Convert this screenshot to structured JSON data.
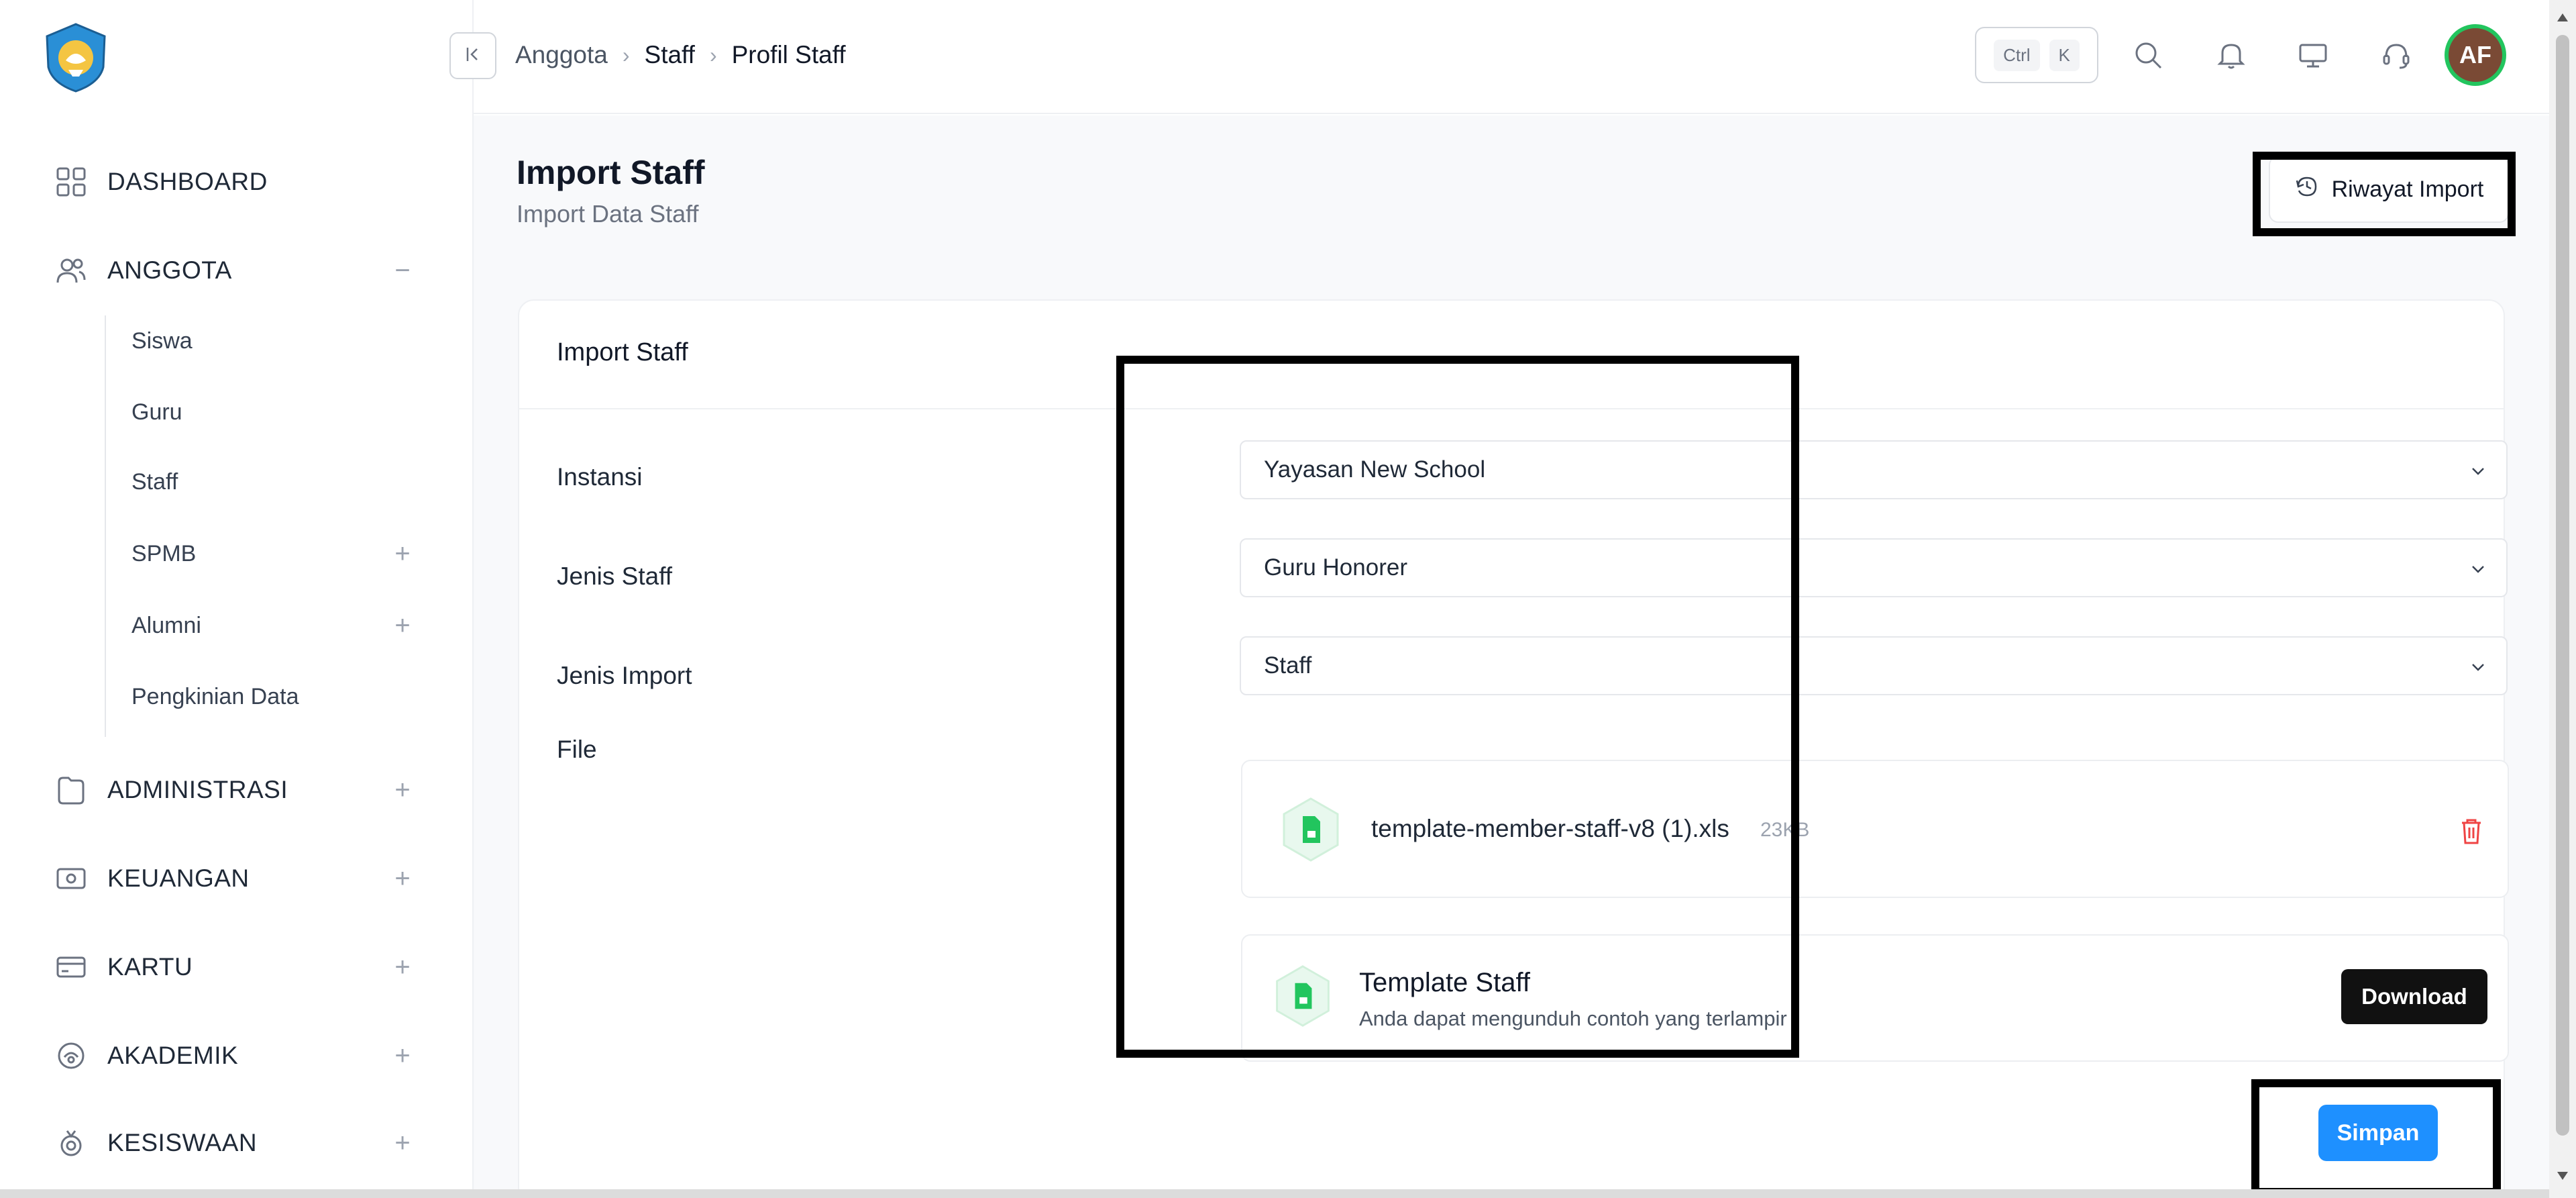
{
  "app": {
    "logo_name": "tut-wuri-handayani-logo"
  },
  "topbar": {
    "breadcrumb": [
      "Anggota",
      "Staff",
      "Profil Staff"
    ],
    "shortcut_keys": [
      "Ctrl",
      "K"
    ],
    "avatar_initials": "AF"
  },
  "sidebar": {
    "items": [
      {
        "label": "DASHBOARD",
        "icon": "grid-icon"
      },
      {
        "label": "ANGGOTA",
        "icon": "users-icon",
        "toggle": "−"
      },
      {
        "label": "ADMINISTRASI",
        "icon": "folder-icon",
        "toggle": "+"
      },
      {
        "label": "KEUANGAN",
        "icon": "cash-icon",
        "toggle": "+"
      },
      {
        "label": "KARTU",
        "icon": "card-icon",
        "toggle": "+"
      },
      {
        "label": "AKADEMIK",
        "icon": "academic-icon",
        "toggle": "+"
      },
      {
        "label": "KESISWAAN",
        "icon": "badge-icon",
        "toggle": "+"
      }
    ],
    "subitems": [
      {
        "label": "Siswa"
      },
      {
        "label": "Guru"
      },
      {
        "label": "Staff"
      },
      {
        "label": "SPMB",
        "toggle": "+"
      },
      {
        "label": "Alumni",
        "toggle": "+"
      },
      {
        "label": "Pengkinian Data"
      }
    ]
  },
  "page": {
    "title": "Import Staff",
    "subtitle": "Import Data Staff",
    "history_button": "Riwayat Import"
  },
  "card": {
    "title": "Import Staff",
    "labels": {
      "instansi": "Instansi",
      "jenis_staff": "Jenis Staff",
      "jenis_import": "Jenis Import",
      "file": "File"
    },
    "selects": {
      "instansi": "Yayasan New School",
      "jenis_staff": "Guru Honorer",
      "jenis_import": "Staff"
    },
    "uploaded_file": {
      "name": "template-member-staff-v8 (1).xls",
      "size": "23KB"
    },
    "template": {
      "title": "Template Staff",
      "description": "Anda dapat mengunduh contoh yang terlampir",
      "download_label": "Download"
    },
    "save_label": "Simpan"
  },
  "colors": {
    "accent_blue": "#1e90ff",
    "file_green": "#22c55e",
    "danger_red": "#ef4444"
  }
}
